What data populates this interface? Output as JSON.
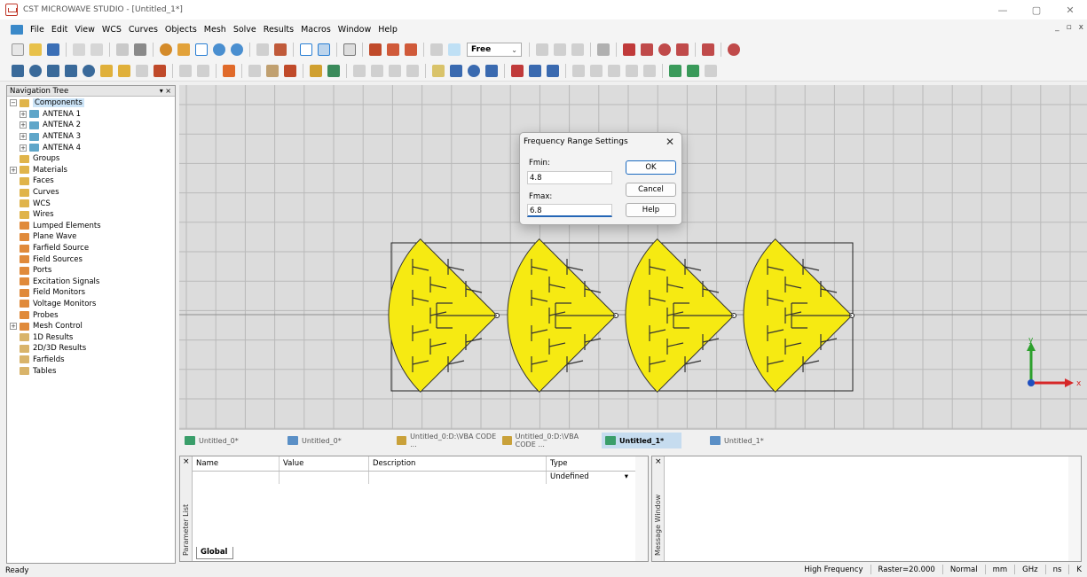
{
  "window": {
    "title": "CST MICROWAVE STUDIO - [Untitled_1*]",
    "minimize": "—",
    "restore": "▢",
    "close": "✕"
  },
  "menu": {
    "items": [
      "File",
      "Edit",
      "View",
      "WCS",
      "Curves",
      "Objects",
      "Mesh",
      "Solve",
      "Results",
      "Macros",
      "Window",
      "Help"
    ],
    "mdi_minimize": "_",
    "mdi_restore": "▫",
    "mdi_close": "x"
  },
  "toolbar": {
    "mode_select": "Free",
    "mode_arrow": "⌄"
  },
  "nav_tree": {
    "title": "Navigation Tree",
    "header_controls": "▾ ×",
    "items": [
      {
        "label": "Components",
        "level": 0,
        "expander": "−",
        "icon_color": "#e0b44a",
        "selected": true
      },
      {
        "label": "ANTENA 1",
        "level": 1,
        "expander": "+",
        "icon_color": "#5fa6c9"
      },
      {
        "label": "ANTENA 2",
        "level": 1,
        "expander": "+",
        "icon_color": "#5fa6c9"
      },
      {
        "label": "ANTENA 3",
        "level": 1,
        "expander": "+",
        "icon_color": "#5fa6c9"
      },
      {
        "label": "ANTENA 4",
        "level": 1,
        "expander": "+",
        "icon_color": "#5fa6c9"
      },
      {
        "label": "Groups",
        "level": 0,
        "expander": "",
        "icon_color": "#e0b44a"
      },
      {
        "label": "Materials",
        "level": 0,
        "expander": "+",
        "icon_color": "#e0b44a"
      },
      {
        "label": "Faces",
        "level": 0,
        "expander": "",
        "icon_color": "#e0b44a"
      },
      {
        "label": "Curves",
        "level": 0,
        "expander": "",
        "icon_color": "#e0b44a"
      },
      {
        "label": "WCS",
        "level": 0,
        "expander": "",
        "icon_color": "#e0b44a"
      },
      {
        "label": "Wires",
        "level": 0,
        "expander": "",
        "icon_color": "#e0b44a"
      },
      {
        "label": "Lumped Elements",
        "level": 0,
        "expander": "",
        "icon_color": "#e08a3a"
      },
      {
        "label": "Plane Wave",
        "level": 0,
        "expander": "",
        "icon_color": "#e08a3a"
      },
      {
        "label": "Farfield Source",
        "level": 0,
        "expander": "",
        "icon_color": "#e08a3a"
      },
      {
        "label": "Field Sources",
        "level": 0,
        "expander": "",
        "icon_color": "#e08a3a"
      },
      {
        "label": "Ports",
        "level": 0,
        "expander": "",
        "icon_color": "#e08a3a"
      },
      {
        "label": "Excitation Signals",
        "level": 0,
        "expander": "",
        "icon_color": "#e08a3a"
      },
      {
        "label": "Field Monitors",
        "level": 0,
        "expander": "",
        "icon_color": "#e08a3a"
      },
      {
        "label": "Voltage Monitors",
        "level": 0,
        "expander": "",
        "icon_color": "#e08a3a"
      },
      {
        "label": "Probes",
        "level": 0,
        "expander": "",
        "icon_color": "#e08a3a"
      },
      {
        "label": "Mesh Control",
        "level": 0,
        "expander": "+",
        "icon_color": "#e08a3a"
      },
      {
        "label": "1D Results",
        "level": 0,
        "expander": "",
        "icon_color": "#d9b46a"
      },
      {
        "label": "2D/3D Results",
        "level": 0,
        "expander": "",
        "icon_color": "#d9b46a"
      },
      {
        "label": "Farfields",
        "level": 0,
        "expander": "",
        "icon_color": "#d9b46a"
      },
      {
        "label": "Tables",
        "level": 0,
        "expander": "",
        "icon_color": "#d9b46a"
      }
    ]
  },
  "axes": {
    "x_label": "x",
    "y_label": "y"
  },
  "dialog": {
    "title": "Frequency Range Settings",
    "close": "✕",
    "fmin_label": "Fmin:",
    "fmin_value": "4.8",
    "fmax_label": "Fmax:",
    "fmax_value": "6.8",
    "ok": "OK",
    "cancel": "Cancel",
    "help": "Help"
  },
  "tabs": [
    {
      "label": "Untitled_0*",
      "icon_color": "#3a9e6a",
      "active": false
    },
    {
      "label": "Untitled_0*",
      "icon_color": "#5a8fc6",
      "active": false
    },
    {
      "label": "Untitled_0:D:\\VBA CODE ...",
      "icon_color": "#c9a13a",
      "active": false
    },
    {
      "label": "Untitled_0:D:\\VBA CODE ...",
      "icon_color": "#c9a13a",
      "active": false
    },
    {
      "label": "Untitled_1*",
      "icon_color": "#3a9e6a",
      "active": true
    },
    {
      "label": "Untitled_1*",
      "icon_color": "#5a8fc6",
      "active": false
    }
  ],
  "param_list": {
    "side_title": "Parameter List",
    "close": "×",
    "columns": [
      "Name",
      "Value",
      "Description",
      "Type"
    ],
    "row_type": "Undefined",
    "row_type_arrow": "▾",
    "global_tab": "Global"
  },
  "message_window": {
    "side_title": "Message Window",
    "close": "×"
  },
  "status": {
    "left": "Ready",
    "mode": "High Frequency",
    "raster": "Raster=20.000",
    "view_mode": "Normal",
    "units": [
      "mm",
      "GHz",
      "ns",
      "K"
    ]
  }
}
